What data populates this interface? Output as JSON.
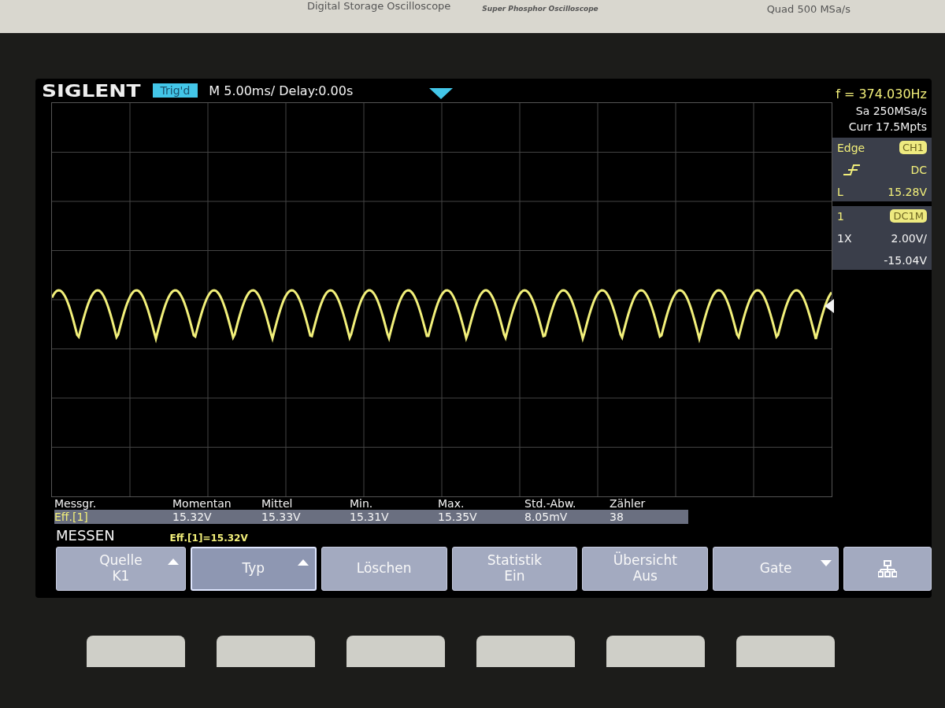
{
  "bezel": {
    "model_text": "Digital Storage Oscilloscope",
    "series_text": "Super Phosphor Oscilloscope",
    "spec_text": "Quad 500 MSa/s"
  },
  "header": {
    "logo": "SIGLENT",
    "trigger_status": "Trig'd",
    "timebase": "M 5.00ms/ Delay:0.00s"
  },
  "right_panel": {
    "frequency": "f = 374.030Hz",
    "sample_rate": "Sa 250MSa/s",
    "memory_depth": "Curr 17.5Mpts",
    "trigger": {
      "type": "Edge",
      "source": "CH1",
      "coupling": "DC",
      "level_label": "L",
      "level": "15.28V"
    },
    "channel": {
      "number": "1",
      "coupling": "DC1M",
      "probe": "1X",
      "scale": "2.00V/",
      "offset": "-15.04V"
    }
  },
  "measurements": {
    "columns": [
      "Messgr.",
      "Momentan",
      "Mittel",
      "Min.",
      "Max.",
      "Std.-Abw.",
      "Zähler"
    ],
    "rows": [
      [
        "Eff.[1]",
        "15.32V",
        "15.33V",
        "15.31V",
        "15.35V",
        "8.05mV",
        "38"
      ]
    ]
  },
  "menu": {
    "title": "MESSEN",
    "readout": "Eff.[1]=15.32V",
    "softkeys": [
      {
        "kind": "up",
        "lines": [
          "Quelle",
          "K1"
        ],
        "selected": false
      },
      {
        "kind": "up",
        "lines": [
          "Typ"
        ],
        "selected": true
      },
      {
        "kind": "plain",
        "lines": [
          "Löschen"
        ],
        "selected": false
      },
      {
        "kind": "plain",
        "lines": [
          "Statistik",
          "Ein"
        ],
        "selected": false
      },
      {
        "kind": "plain",
        "lines": [
          "Übersicht",
          "Aus"
        ],
        "selected": false
      },
      {
        "kind": "down",
        "lines": [
          "Gate"
        ],
        "selected": false
      },
      {
        "kind": "network",
        "selected": false
      }
    ]
  }
}
